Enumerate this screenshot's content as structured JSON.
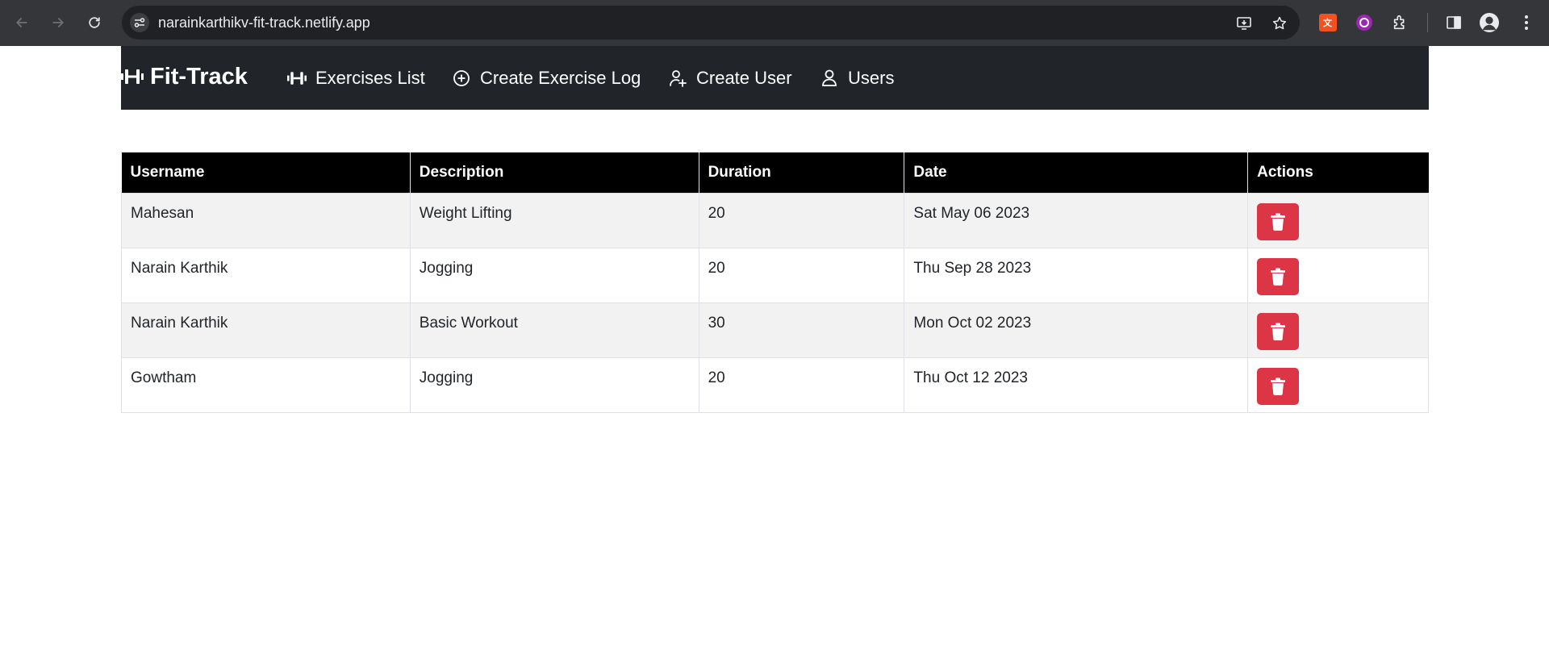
{
  "browser": {
    "url": "narainkarthikv-fit-track.netlify.app",
    "icons": [
      "back-arrow-icon",
      "forward-arrow-icon",
      "reload-icon",
      "site-info-icon",
      "install-app-icon",
      "bookmark-star-icon",
      "extension-translate-icon",
      "extension-purple-icon",
      "extensions-puzzle-icon",
      "side-panel-icon",
      "profile-avatar-icon",
      "menu-kebab-icon"
    ]
  },
  "nav": {
    "brand": "Fit-Track",
    "links": [
      {
        "label": "Exercises List",
        "icon": "dumbbell-icon"
      },
      {
        "label": "Create Exercise Log",
        "icon": "plus-circle-icon"
      },
      {
        "label": "Create User",
        "icon": "person-plus-icon"
      },
      {
        "label": "Users",
        "icon": "person-icon"
      }
    ]
  },
  "table": {
    "headers": [
      "Username",
      "Description",
      "Duration",
      "Date",
      "Actions"
    ],
    "rows": [
      {
        "username": "Mahesan",
        "description": "Weight Lifting",
        "duration": "20",
        "date": "Sat May 06 2023"
      },
      {
        "username": "Narain Karthik",
        "description": "Jogging",
        "duration": "20",
        "date": "Thu Sep 28 2023"
      },
      {
        "username": "Narain Karthik",
        "description": "Basic Workout",
        "duration": "30",
        "date": "Mon Oct 02 2023"
      },
      {
        "username": "Gowtham",
        "description": "Jogging",
        "duration": "20",
        "date": "Thu Oct 12 2023"
      }
    ]
  },
  "colors": {
    "browser_bar": "#35363a",
    "omnibox": "#202124",
    "navbar": "#212529",
    "table_header": "#000000",
    "stripe": "#f2f2f2",
    "delete_button": "#dc3545"
  }
}
